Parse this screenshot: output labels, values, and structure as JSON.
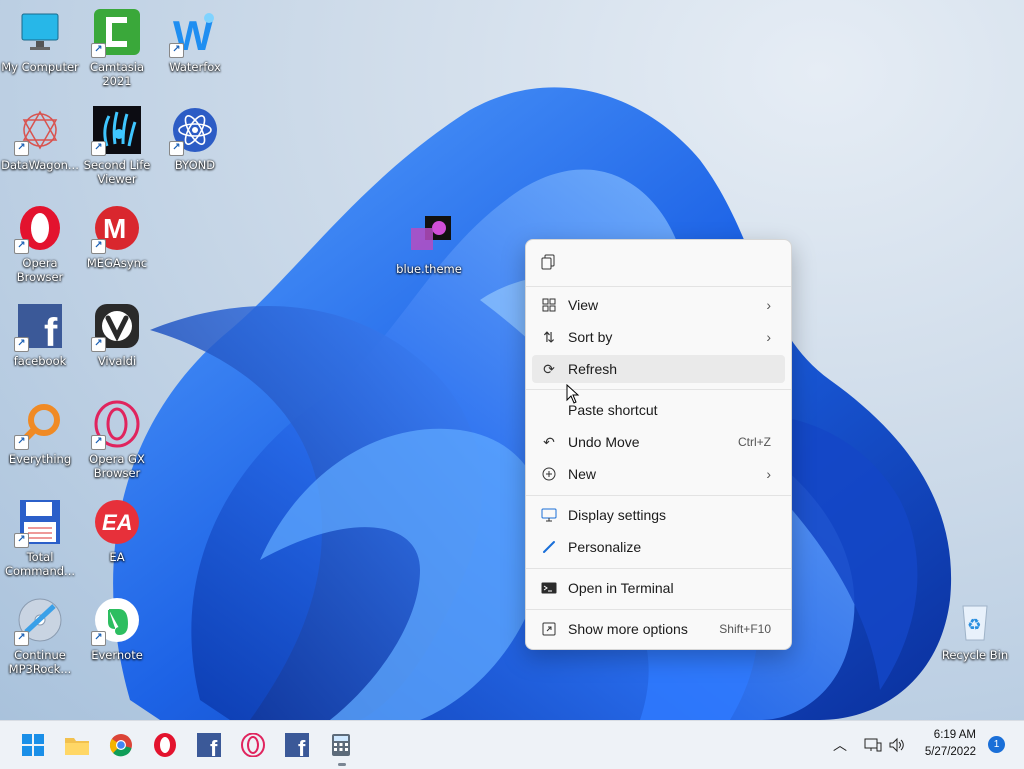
{
  "desktop_icons": [
    {
      "label": "My Computer"
    },
    {
      "label": "Camtasia 2021"
    },
    {
      "label": "Waterfox"
    },
    {
      "label": "DataWagon..."
    },
    {
      "label": "Second Life Viewer"
    },
    {
      "label": "BYOND"
    },
    {
      "label": "Opera Browser"
    },
    {
      "label": "MEGAsync"
    },
    {
      "label": "facebook"
    },
    {
      "label": "Vivaldi"
    },
    {
      "label": "Everything"
    },
    {
      "label": "Opera GX Browser"
    },
    {
      "label": "Total Command..."
    },
    {
      "label": "EA"
    },
    {
      "label": "Continue MP3Rock..."
    },
    {
      "label": "Evernote"
    },
    {
      "label": "blue.theme"
    },
    {
      "label": "Recycle Bin"
    }
  ],
  "context_menu": {
    "items": [
      {
        "label": "View"
      },
      {
        "label": "Sort by"
      },
      {
        "label": "Refresh"
      },
      {
        "label": "Paste shortcut"
      },
      {
        "label": "Undo Move",
        "shortcut": "Ctrl+Z"
      },
      {
        "label": "New"
      },
      {
        "label": "Display settings"
      },
      {
        "label": "Personalize"
      },
      {
        "label": "Open in Terminal"
      },
      {
        "label": "Show more options",
        "shortcut": "Shift+F10"
      }
    ]
  },
  "taskbar": {
    "apps": [
      "start-icon",
      "file-explorer-icon",
      "chrome-icon",
      "opera-icon",
      "facebook-icon",
      "opera-gx-icon",
      "facebook-icon",
      "calculator-icon"
    ],
    "clock": {
      "time": "6:19 AM",
      "date": "5/27/2022"
    },
    "notification_count": "1"
  },
  "colors": {
    "accent": "#1a6fd8",
    "wallpaper_blue": "#1e5fe0"
  }
}
